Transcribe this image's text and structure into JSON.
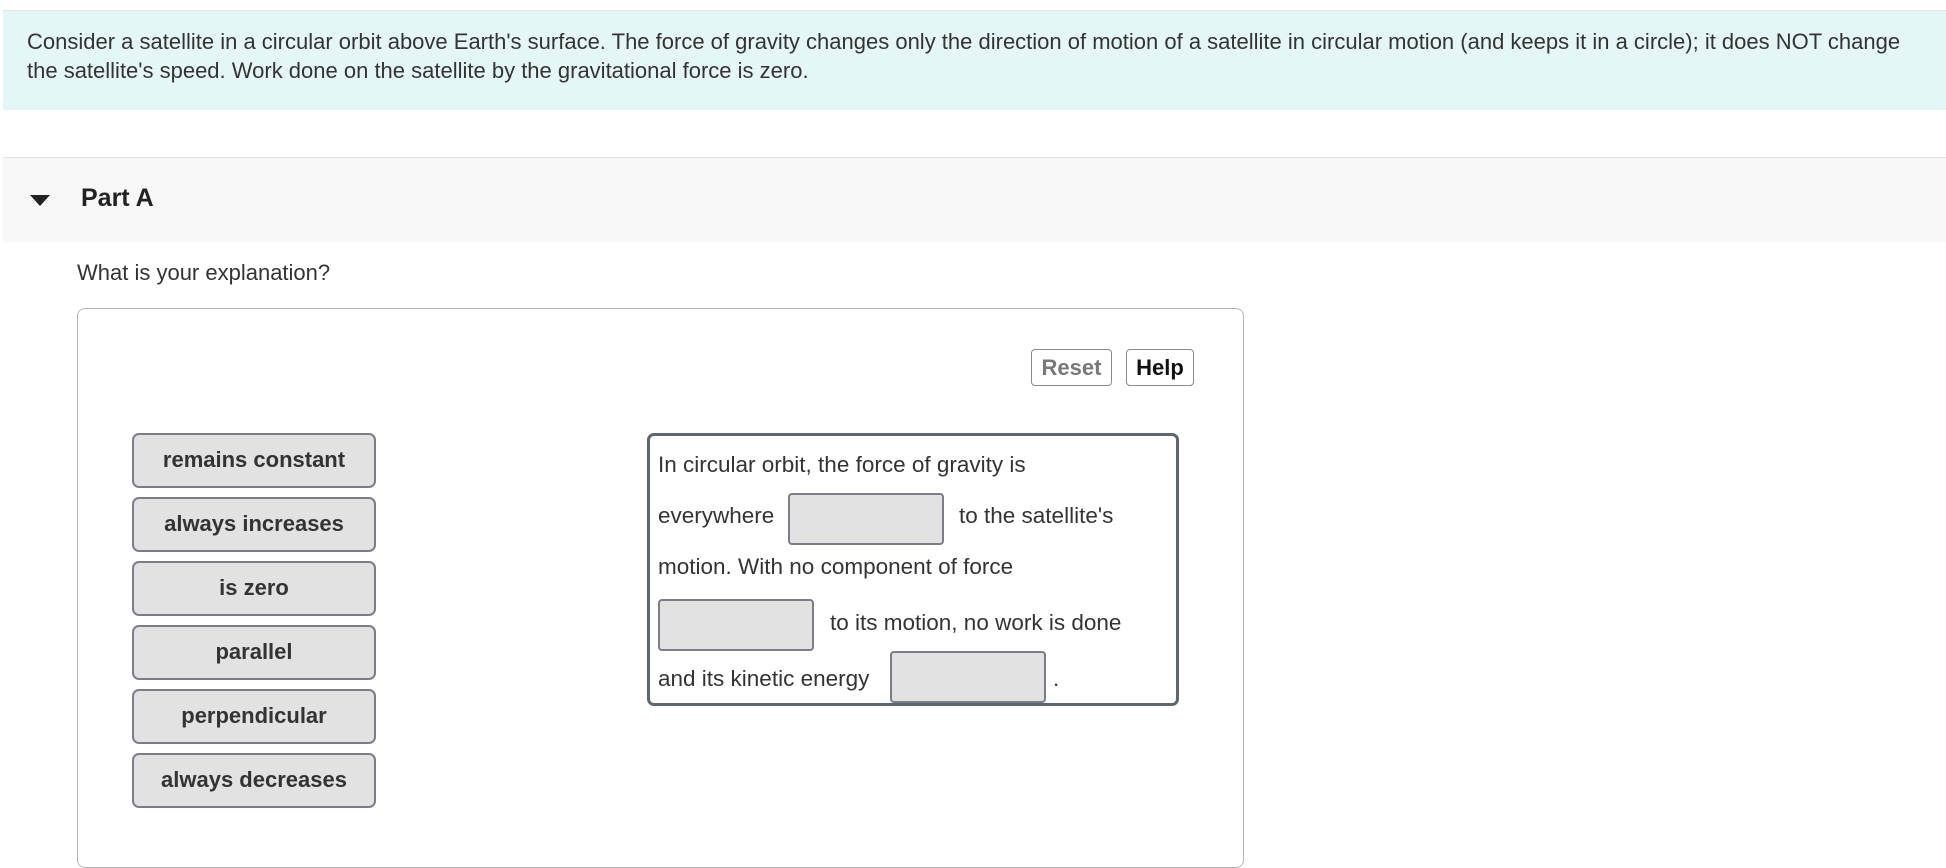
{
  "intro": {
    "text": "Consider a satellite in a circular orbit above Earth's surface. The force of gravity changes only the direction of motion of a satellite in circular motion (and keeps it in a circle); it does NOT change the satellite's speed. Work done on the satellite by the gravitational force is zero."
  },
  "part": {
    "title": "Part A",
    "expanded": true,
    "caret_icon": "caret-down-icon",
    "prompt": "What is your explanation?"
  },
  "toolbar": {
    "reset_label": "Reset",
    "help_label": "Help"
  },
  "labels": [
    "remains constant",
    "always increases",
    "is zero",
    "parallel",
    "perpendicular",
    "always decreases"
  ],
  "sentence": {
    "line1": "In circular orbit, the force of gravity is",
    "line2_before": "everywhere",
    "line2_after": "to the satellite's",
    "line3": "motion. With no component of force",
    "line4_after": "to its motion, no work is done",
    "line5_before": "and its kinetic energy",
    "line5_after": ".",
    "blanks": [
      "",
      "",
      ""
    ]
  }
}
